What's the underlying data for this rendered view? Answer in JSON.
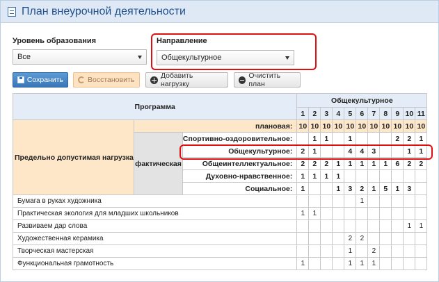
{
  "window": {
    "title": "План внеурочной деятельности"
  },
  "filters": {
    "level_label": "Уровень образования",
    "level_value": "Все",
    "direction_label": "Направление",
    "direction_value": "Общекультурное"
  },
  "toolbar": {
    "save_label": "Сохранить",
    "restore_label": "Восстановить",
    "add_load_label": "Добавить нагрузку",
    "clear_plan_label": "Очистить план"
  },
  "table": {
    "program_header": "Программа",
    "direction_header": "Общекультурное",
    "columns": [
      "1",
      "2",
      "3",
      "4",
      "5",
      "6",
      "7",
      "8",
      "9",
      "10",
      "11"
    ],
    "max_load_label": "Предельно допустимая нагрузка",
    "planned_label": "плановая:",
    "planned_values": [
      "10",
      "10",
      "10",
      "10",
      "10",
      "10",
      "10",
      "10",
      "10",
      "10",
      "10"
    ],
    "actual_label": "фактическая",
    "categories": [
      {
        "name": "Спортивно-оздоровительное:",
        "values": [
          "",
          "1",
          "1",
          "",
          "1",
          "",
          "",
          "",
          "2",
          "2",
          "1"
        ]
      },
      {
        "name": "Общекультурное:",
        "values": [
          "2",
          "1",
          "",
          "",
          "4",
          "4",
          "3",
          "",
          "",
          "1",
          "1"
        ]
      },
      {
        "name": "Общеинтеллектуальное:",
        "values": [
          "2",
          "2",
          "2",
          "1",
          "1",
          "1",
          "1",
          "1",
          "6",
          "2",
          "2"
        ]
      },
      {
        "name": "Духовно-нравственное:",
        "values": [
          "1",
          "1",
          "1",
          "1",
          "",
          "",
          "",
          "",
          "",
          "",
          ""
        ]
      },
      {
        "name": "Социальное:",
        "values": [
          "1",
          "",
          "",
          "1",
          "3",
          "2",
          "1",
          "5",
          "1",
          "3",
          ""
        ]
      }
    ],
    "programs": [
      {
        "name": "Бумага в руках художника",
        "values": [
          "",
          "",
          "",
          "",
          "",
          "1",
          "",
          "",
          "",
          "",
          ""
        ]
      },
      {
        "name": "Практическая экология для младших школьников",
        "values": [
          "1",
          "1",
          "",
          "",
          "",
          "",
          "",
          "",
          "",
          "",
          ""
        ]
      },
      {
        "name": "Развиваем дар слова",
        "values": [
          "",
          "",
          "",
          "",
          "",
          "",
          "",
          "",
          "",
          "1",
          "1"
        ]
      },
      {
        "name": "Художественная керамика",
        "values": [
          "",
          "",
          "",
          "",
          "2",
          "2",
          "",
          "",
          "",
          "",
          ""
        ]
      },
      {
        "name": "Творческая мастерская",
        "values": [
          "",
          "",
          "",
          "",
          "1",
          "",
          "2",
          "",
          "",
          "",
          ""
        ]
      },
      {
        "name": "Функциональная грамотность",
        "values": [
          "1",
          "",
          "",
          "",
          "1",
          "1",
          "1",
          "",
          "",
          "",
          ""
        ]
      }
    ]
  }
}
